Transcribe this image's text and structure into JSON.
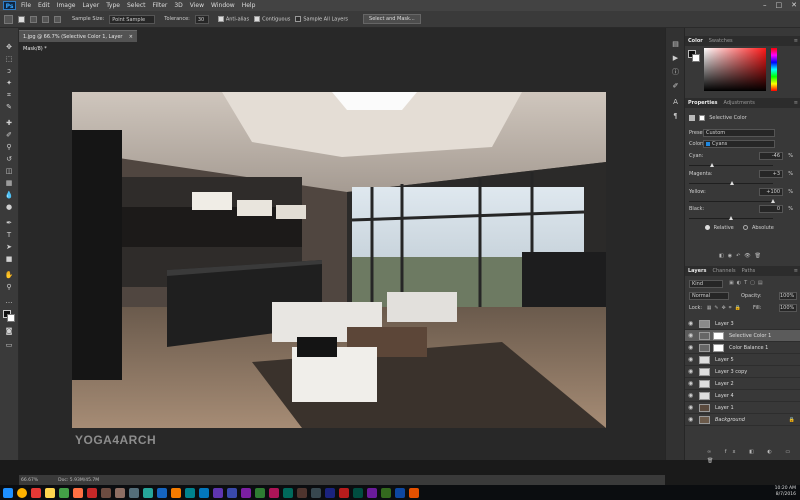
{
  "app": {
    "logo": "Ps"
  },
  "menu": [
    "File",
    "Edit",
    "Image",
    "Layer",
    "Type",
    "Select",
    "Filter",
    "3D",
    "View",
    "Window",
    "Help"
  ],
  "window_controls": {
    "minimize": "–",
    "maximize": "□",
    "close": "✕"
  },
  "options": {
    "sample_size_label": "Sample Size:",
    "sample_size_value": "Point Sample",
    "tolerance_label": "Tolerance:",
    "tolerance_value": "30",
    "anti_alias": "Anti-alias",
    "contiguous": "Contiguous",
    "sample_all_layers": "Sample All Layers",
    "select_mask_button": "Select and Mask..."
  },
  "document": {
    "tab_title": "1.jpg @ 66.7% (Selective Color 1, Layer Mask/8) *",
    "close": "×",
    "watermark": "YOGA4ARCH"
  },
  "status": {
    "zoom": "66.67%",
    "doc": "Doc: 5.93M/45.7M"
  },
  "color_panel": {
    "tabs": [
      "Color",
      "Swatches"
    ],
    "menu": "≡"
  },
  "properties_panel": {
    "tabs": [
      "Properties",
      "Adjustments"
    ],
    "title": "Selective Color",
    "preset_label": "Preset:",
    "preset_value": "Custom",
    "colors_label": "Colors:",
    "colors_value": "Cyans",
    "cyan_label": "Cyan:",
    "cyan_value": "-46",
    "magenta_label": "Magenta:",
    "magenta_value": "+3",
    "yellow_label": "Yellow:",
    "yellow_value": "+100",
    "black_label": "Black:",
    "black_value": "0",
    "pct": "%",
    "relative": "Relative",
    "absolute": "Absolute",
    "slider_levels": {
      "cyan": -46,
      "magenta": 3,
      "yellow": 100,
      "black": 0
    }
  },
  "layers_panel": {
    "tabs": [
      "Layers",
      "Channels",
      "Paths"
    ],
    "kind": "Kind",
    "blend_mode": "Normal",
    "opacity_label": "Opacity:",
    "opacity_value": "100%",
    "lock_label": "Lock:",
    "fill_label": "Fill:",
    "fill_value": "100%",
    "layers": [
      {
        "name": "Layer 3"
      },
      {
        "name": "Selective Color 1"
      },
      {
        "name": "Color Balance 1"
      },
      {
        "name": "Layer 5"
      },
      {
        "name": "Layer 3 copy"
      },
      {
        "name": "Layer 2"
      },
      {
        "name": "Layer 4"
      },
      {
        "name": "Layer 1"
      },
      {
        "name": "Background"
      }
    ]
  },
  "tray": {
    "time": "10:20 AM",
    "date": "8/7/2016"
  }
}
